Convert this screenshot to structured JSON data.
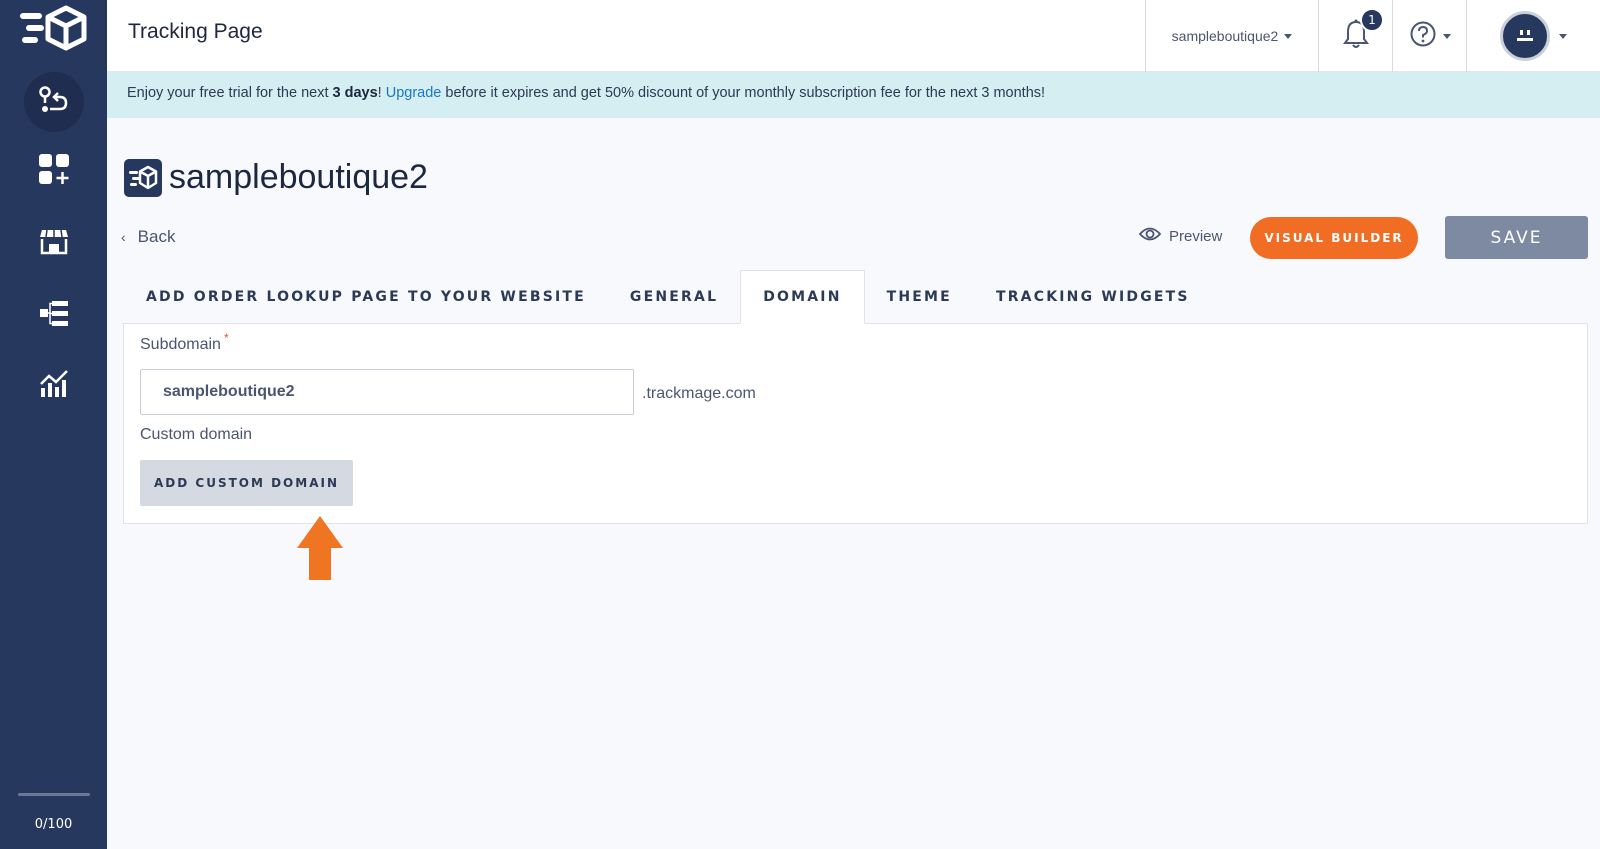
{
  "header": {
    "title": "Tracking Page",
    "store_selector": "sampleboutique2",
    "notification_count": "1"
  },
  "banner": {
    "text_before": "Enjoy your free trial for the next ",
    "days": "3 days",
    "exclaim": "! ",
    "upgrade_link": "Upgrade",
    "text_after": " before it expires and get 50% discount of your monthly subscription fee for the next 3 months!"
  },
  "page": {
    "store_name": "sampleboutique2",
    "back_label": "Back",
    "preview_label": "Preview",
    "visual_builder_label": "VISUAL BUILDER",
    "save_label": "SAVE"
  },
  "tabs": [
    {
      "label": "ADD ORDER LOOKUP PAGE TO YOUR WEBSITE",
      "active": false
    },
    {
      "label": "GENERAL",
      "active": false
    },
    {
      "label": "DOMAIN",
      "active": true
    },
    {
      "label": "THEME",
      "active": false
    },
    {
      "label": "TRACKING WIDGETS",
      "active": false
    }
  ],
  "domain": {
    "subdomain_label": "Subdomain",
    "required_mark": "*",
    "subdomain_value": "sampleboutique2",
    "subdomain_suffix": ".trackmage.com",
    "custom_domain_label": "Custom domain",
    "add_custom_domain_label": "ADD CUSTOM DOMAIN"
  },
  "sidebar": {
    "items": [
      {
        "icon": "route-icon",
        "active": true
      },
      {
        "icon": "add-widgets-icon",
        "active": false
      },
      {
        "icon": "store-icon",
        "active": false
      },
      {
        "icon": "workflow-icon",
        "active": false
      },
      {
        "icon": "analytics-icon",
        "active": false
      }
    ],
    "usage_counter": "0/100"
  },
  "colors": {
    "sidebar": "#27385e",
    "accent": "#f06d23",
    "banner_bg": "#d4eef1",
    "link": "#1a78c2"
  }
}
